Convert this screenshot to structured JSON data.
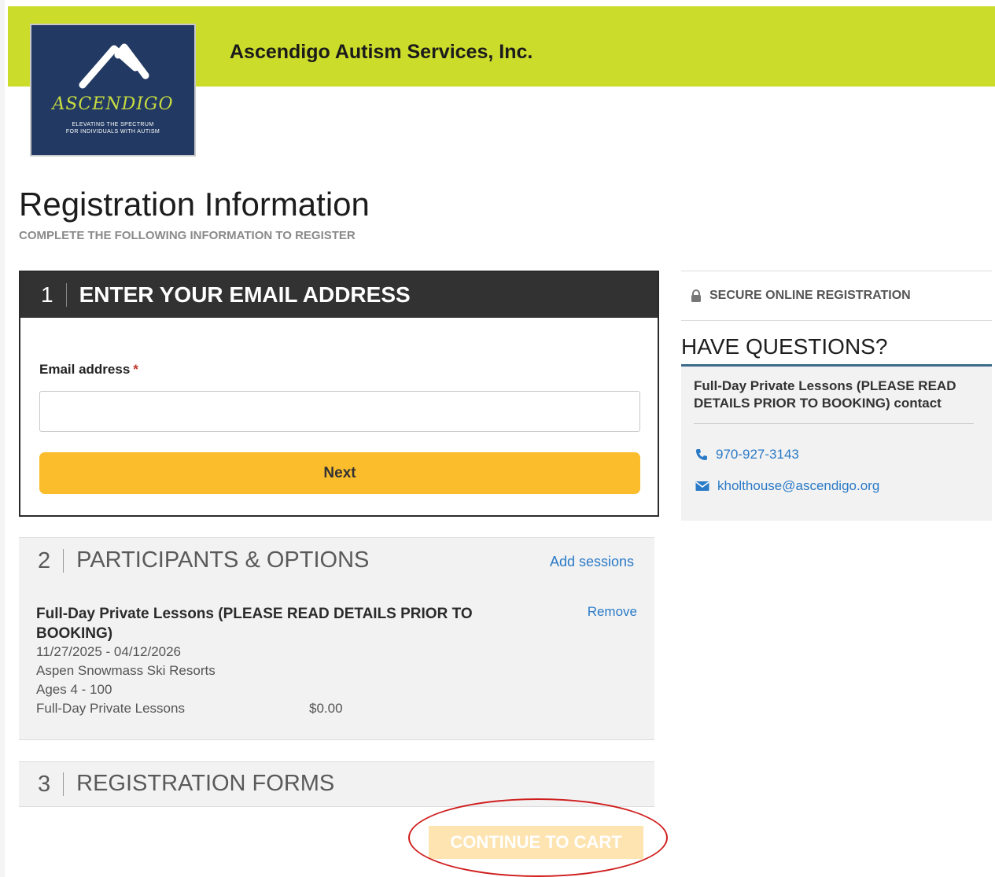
{
  "header": {
    "org_name": "Ascendigo Autism Services, Inc.",
    "logo_word": "ASCENDIGO",
    "logo_tagline_1": "ELEVATING THE SPECTRUM",
    "logo_tagline_2": "FOR INDIVIDUALS WITH AUTISM",
    "banner_color": "#cbdc2b"
  },
  "page": {
    "title": "Registration Information",
    "subtitle": "COMPLETE THE FOLLOWING INFORMATION TO REGISTER"
  },
  "step1": {
    "number": "1",
    "title": "ENTER YOUR EMAIL ADDRESS",
    "email_label": "Email address",
    "required_mark": "*",
    "email_value": "",
    "next_label": "Next"
  },
  "step2": {
    "number": "2",
    "title": "PARTICIPANTS & OPTIONS",
    "add_sessions_label": "Add sessions",
    "lesson": {
      "title": "Full-Day Private Lessons (PLEASE READ DETAILS PRIOR TO BOOKING)",
      "remove_label": "Remove",
      "dates": "11/27/2025 - 04/12/2026",
      "location": "Aspen Snowmass Ski Resorts",
      "ages": "Ages 4 - 100",
      "option_name": "Full-Day Private Lessons",
      "price": "$0.00"
    }
  },
  "step3": {
    "number": "3",
    "title": "REGISTRATION FORMS"
  },
  "continue_label": "CONTINUE TO CART",
  "sidebar": {
    "secure_label": "SECURE ONLINE REGISTRATION",
    "questions_title": "HAVE QUESTIONS?",
    "contact_title": "Full-Day Private Lessons (PLEASE READ DETAILS PRIOR TO BOOKING) contact",
    "phone": "970-927-3143",
    "email": "kholthouse@ascendigo.org"
  },
  "colors": {
    "accent_button": "#fcbd2c",
    "link": "#2a7ac7",
    "dark_header": "#323232",
    "annotation_circle": "#d01e1e"
  }
}
